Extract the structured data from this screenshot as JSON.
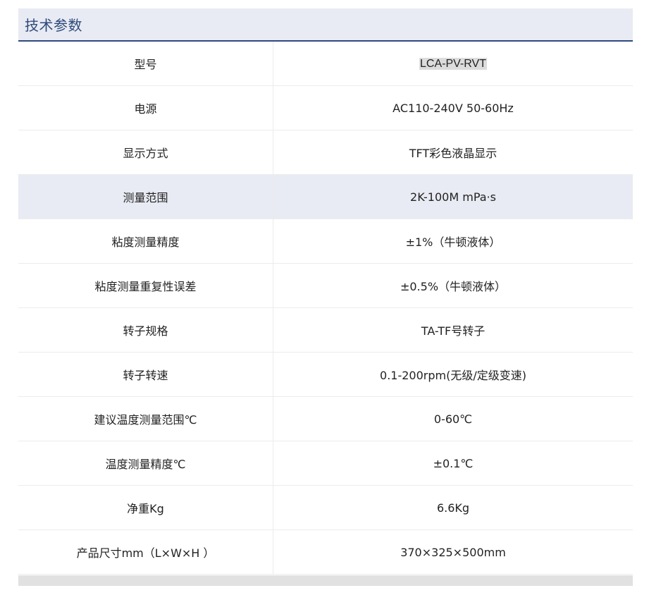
{
  "section": {
    "title": "技术参数"
  },
  "specs": [
    {
      "label": "型号",
      "value": "LCA-PV-RVT"
    },
    {
      "label": "电源",
      "value": "AC110-240V 50-60Hz"
    },
    {
      "label": "显示方式",
      "value": "TFT彩色液晶显示"
    },
    {
      "label": "测量范围",
      "value": "2K-100M mPa·s"
    },
    {
      "label": "粘度测量精度",
      "value": "±1%（牛顿液体）"
    },
    {
      "label": "粘度测量重复性误差",
      "value": "±0.5%（牛顿液体）"
    },
    {
      "label": "转子规格",
      "value": "TA-TF号转子"
    },
    {
      "label": "转子转速",
      "value": "0.1-200rpm(无级/定级变速)"
    },
    {
      "label": "建议温度测量范围℃",
      "value": "0-60℃"
    },
    {
      "label": "温度测量精度℃",
      "value": "±0.1℃"
    },
    {
      "label": "净重Kg",
      "value": "6.6Kg"
    },
    {
      "label": "产品尺寸mm（L×W×H ）",
      "value": "370×325×500mm"
    }
  ],
  "colors": {
    "header_bg": "#e8ebf3",
    "header_text": "#2f4a7c",
    "header_border": "#2f4a7c",
    "highlight_row_bg": "#e8ebf3",
    "footer_bar": "#e1e1e1"
  }
}
